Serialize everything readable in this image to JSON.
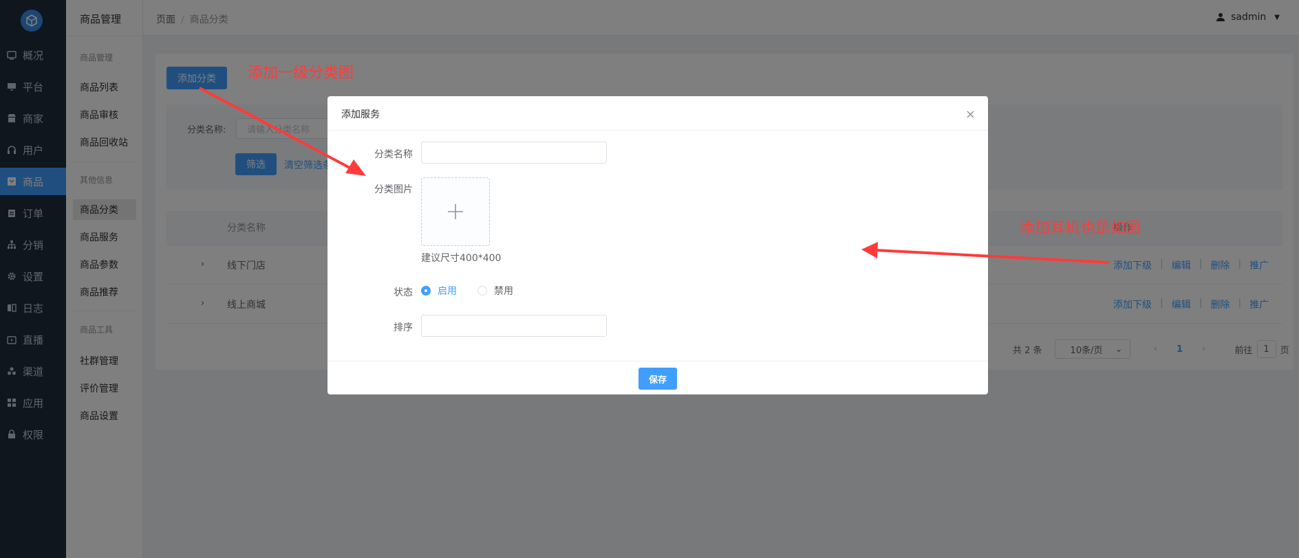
{
  "nav": {
    "items": [
      {
        "label": "概况",
        "icon": "dashboard-icon"
      },
      {
        "label": "平台",
        "icon": "monitor-icon"
      },
      {
        "label": "商家",
        "icon": "store-icon"
      },
      {
        "label": "用户",
        "icon": "headset-icon"
      },
      {
        "label": "商品",
        "icon": "goods-icon",
        "active": true
      },
      {
        "label": "订单",
        "icon": "clipboard-icon"
      },
      {
        "label": "分销",
        "icon": "hierarchy-icon"
      },
      {
        "label": "设置",
        "icon": "gear-icon"
      },
      {
        "label": "日志",
        "icon": "book-icon"
      },
      {
        "label": "直播",
        "icon": "live-icon"
      },
      {
        "label": "渠道",
        "icon": "channel-icon"
      },
      {
        "label": "应用",
        "icon": "grid-icon"
      },
      {
        "label": "权限",
        "icon": "lock-icon"
      }
    ]
  },
  "subnav": {
    "title": "商品管理",
    "group1": "商品管理",
    "group2": "其他信息",
    "group3": "商品工具",
    "items": [
      "商品列表",
      "商品审核",
      "商品回收站",
      "商品分类",
      "商品服务",
      "商品参数",
      "商品推荐",
      "社群管理",
      "评价管理",
      "商品设置"
    ]
  },
  "header": {
    "crumb_root": "页面",
    "crumb_sep": "/",
    "crumb_current": "商品分类",
    "username": "sadmin"
  },
  "page": {
    "add_button": "添加分类",
    "filter_label": "分类名称:",
    "filter_placeholder": "请输入分类名称",
    "filter_button": "筛选",
    "clear_link": "清空筛选条件",
    "col_name": "分类名称",
    "col_ops": "操作",
    "rows": [
      {
        "name": "线下门店"
      },
      {
        "name": "线上商城"
      }
    ],
    "ops": {
      "add_child": "添加下级",
      "edit": "编辑",
      "delete": "删除",
      "promote": "推广",
      "pipe": "|"
    },
    "pager": {
      "total": "共 2 条",
      "size": "10条/页",
      "current": "1",
      "goto_pre": "前往",
      "goto_val": "1",
      "goto_post": "页"
    }
  },
  "dialog": {
    "title": "添加服务",
    "close": "×",
    "name_label": "分类名称",
    "image_label": "分类图片",
    "size_hint": "建议尺寸400*400",
    "status_label": "状态",
    "status_on": "启用",
    "status_off": "禁用",
    "sort_label": "排序",
    "save_button": "保存"
  },
  "annotations": {
    "top": "添加一级分类图",
    "right": "添加耳机也是如图",
    "color": "#ff3b3b"
  }
}
